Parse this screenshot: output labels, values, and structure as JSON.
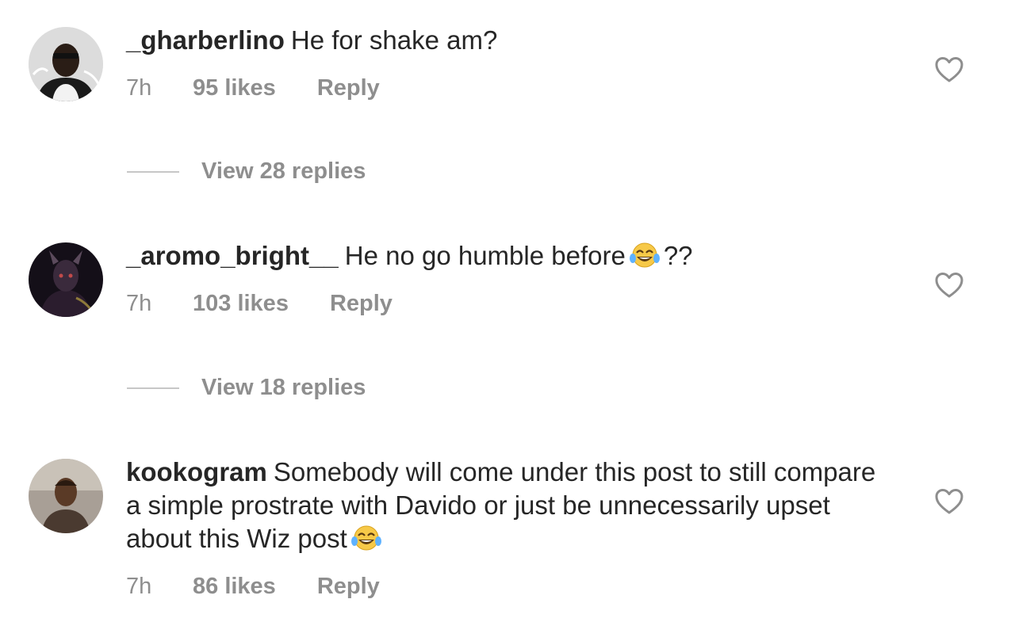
{
  "comments": [
    {
      "username": "_gharberlino",
      "text": "He for shake am?",
      "text_after_emoji": "",
      "time": "7h",
      "likes": "95 likes",
      "reply": "Reply",
      "view_replies": "View 28 replies"
    },
    {
      "username": "_aromo_bright__",
      "text": "He no go humble before",
      "text_after_emoji": "??",
      "time": "7h",
      "likes": "103 likes",
      "reply": "Reply",
      "view_replies": "View 18 replies"
    },
    {
      "username": "kookogram",
      "text": "Somebody will come under this post to still compare a simple prostrate with Davido or just be unnecessarily upset about this Wiz post",
      "text_after_emoji": "",
      "time": "7h",
      "likes": "86 likes",
      "reply": "Reply"
    }
  ],
  "icons": {
    "like": "heart-outline-icon",
    "emoji": "face-with-tears-of-joy"
  },
  "colors": {
    "text": "#262626",
    "secondary": "#8e8e8e",
    "divider": "#c7c7c7",
    "emoji": "#f7c948"
  }
}
